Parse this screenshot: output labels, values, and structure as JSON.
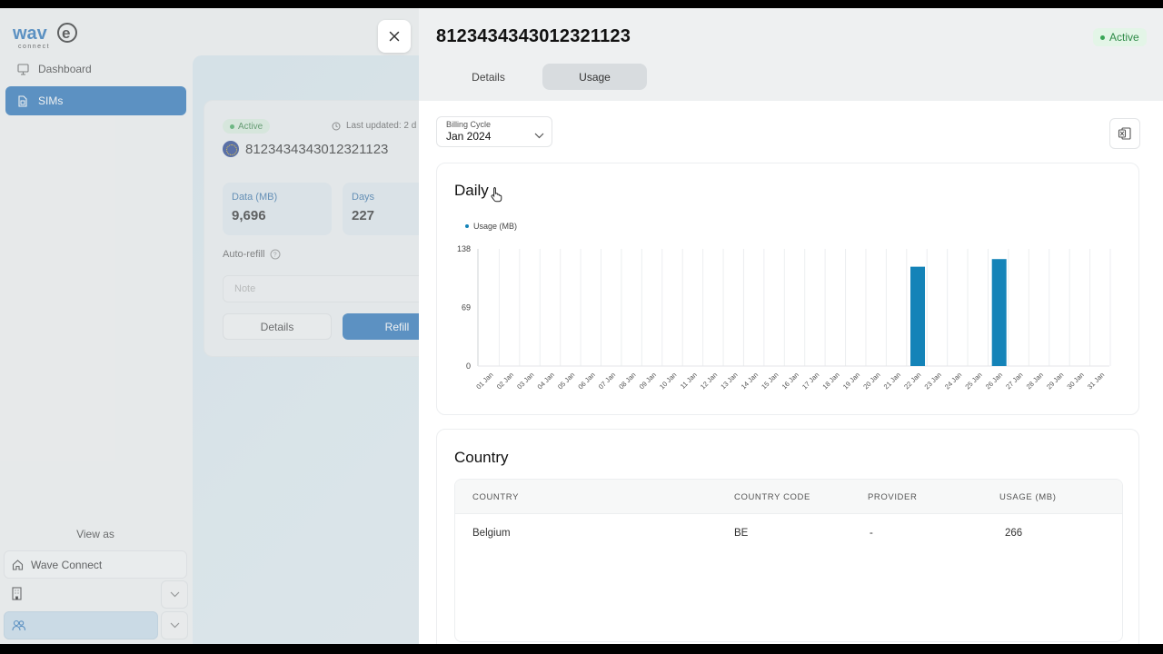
{
  "sidebar": {
    "logo_text": "wave",
    "logo_subtext": "connect",
    "items": [
      {
        "label": "Dashboard",
        "icon": "dashboard-icon"
      },
      {
        "label": "SIMs",
        "icon": "sim-icon",
        "active": true
      }
    ],
    "view_as_label": "View as",
    "org_label": "Wave Connect"
  },
  "sim_card": {
    "status": "Active",
    "last_updated": "Last updated: 2 d",
    "number": "8123434343012321123",
    "stats": [
      {
        "label": "Data (MB)",
        "value": "9,696"
      },
      {
        "label": "Days",
        "value": "227"
      }
    ],
    "auto_refill_label": "Auto-refill",
    "note_placeholder": "Note",
    "details_button": "Details",
    "refill_button": "Refill"
  },
  "drawer": {
    "title": "8123434343012321123",
    "status": "Active",
    "tabs": [
      {
        "label": "Details",
        "active": false
      },
      {
        "label": "Usage",
        "active": true
      }
    ],
    "billing_cycle": {
      "label": "Billing Cycle",
      "value": "Jan 2024"
    },
    "daily_title": "Daily",
    "country_title": "Country",
    "country_table": {
      "headers": [
        "COUNTRY",
        "COUNTRY CODE",
        "PROVIDER",
        "USAGE (MB)"
      ],
      "rows": [
        [
          "Belgium",
          "BE",
          "-",
          "266"
        ]
      ]
    }
  },
  "colors": {
    "accent": "#1e6cb6",
    "bar": "#1483b8",
    "active_green": "#2e8a47"
  },
  "chart_data": {
    "type": "bar",
    "legend": [
      "Usage (MB)"
    ],
    "categories": [
      "01 Jan",
      "02 Jan",
      "03 Jan",
      "04 Jan",
      "05 Jan",
      "06 Jan",
      "07 Jan",
      "08 Jan",
      "09 Jan",
      "10 Jan",
      "11 Jan",
      "12 Jan",
      "13 Jan",
      "14 Jan",
      "15 Jan",
      "16 Jan",
      "17 Jan",
      "18 Jan",
      "19 Jan",
      "20 Jan",
      "21 Jan",
      "22 Jan",
      "23 Jan",
      "24 Jan",
      "25 Jan",
      "26 Jan",
      "27 Jan",
      "28 Jan",
      "29 Jan",
      "30 Jan",
      "31 Jan"
    ],
    "series": [
      {
        "name": "Usage (MB)",
        "values": [
          0,
          0,
          0,
          0,
          0,
          0,
          0,
          0,
          0,
          0,
          0,
          0,
          0,
          0,
          0,
          0,
          0,
          0,
          0,
          0,
          0,
          117,
          0,
          0,
          0,
          126,
          0,
          0,
          0,
          0,
          0
        ]
      }
    ],
    "yticks": [
      "138",
      "69",
      "0"
    ],
    "ylim": [
      0,
      138
    ],
    "grid": true,
    "legend_position": "top-left"
  }
}
